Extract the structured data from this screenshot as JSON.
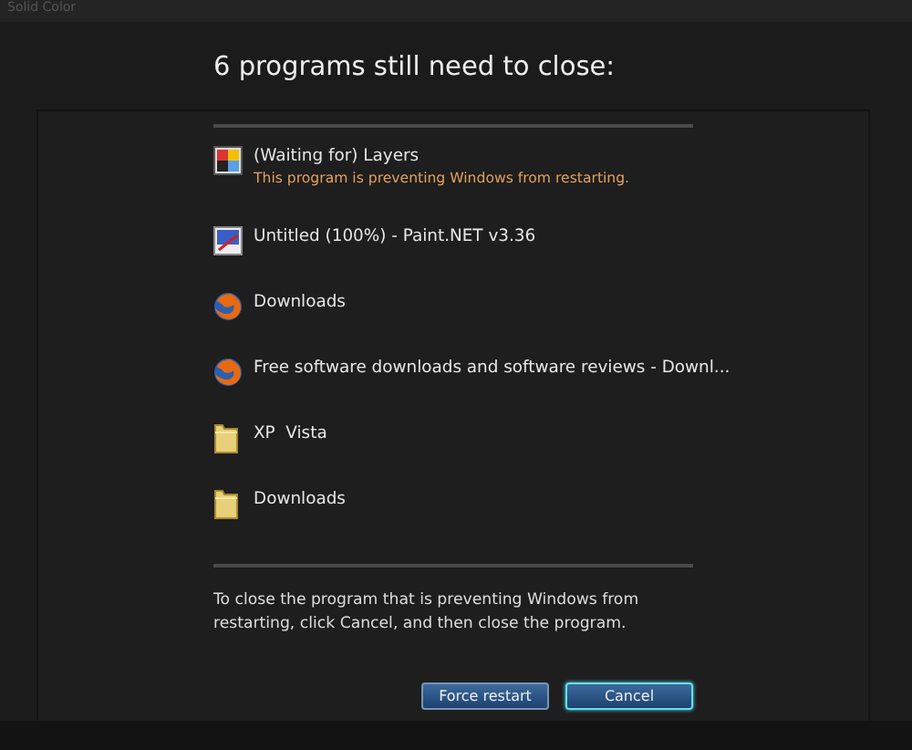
{
  "toolbar": {
    "text": "Solid Color"
  },
  "heading": "6 programs still need to close:",
  "programs": [
    {
      "kind": "layers",
      "title": "(Waiting for) Layers",
      "subtitle": "This program is preventing Windows from restarting."
    },
    {
      "kind": "paint",
      "title": "Untitled (100%) - Paint.NET v3.36"
    },
    {
      "kind": "browser",
      "title": "Downloads"
    },
    {
      "kind": "browser",
      "title": "Free software downloads and software reviews - Downl..."
    },
    {
      "kind": "folder",
      "title": "XP  Vista"
    },
    {
      "kind": "folder",
      "title": "Downloads"
    }
  ],
  "message": "To close the program that is preventing Windows from restarting, click Cancel, and then close the program.",
  "buttons": [
    {
      "label": "Force restart",
      "focused": false
    },
    {
      "label": "Cancel",
      "focused": true
    }
  ]
}
